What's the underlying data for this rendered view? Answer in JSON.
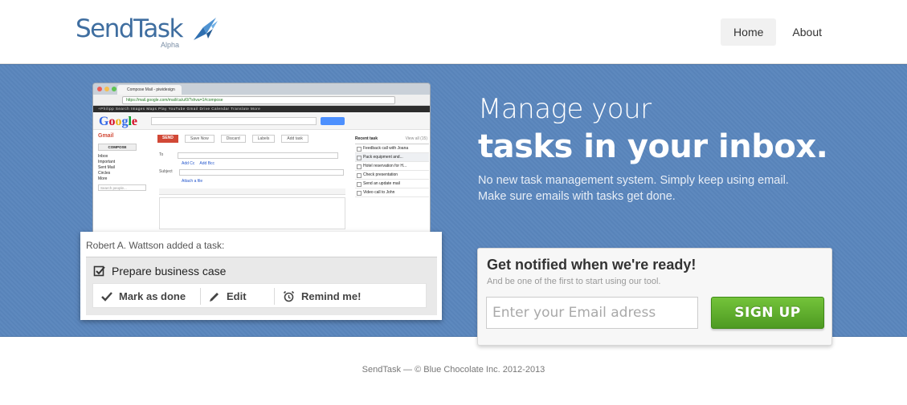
{
  "brand": {
    "name": "SendTask",
    "tagline": "Alpha"
  },
  "nav": {
    "items": [
      {
        "label": "Home"
      },
      {
        "label": "About"
      }
    ]
  },
  "browser_mock": {
    "tab_title": "Compose Mail - piwidesign",
    "url": "https://mail.google.com/mail/ca/u/0/?shva=1#compose",
    "google_bar": "+Philipp   Search   Images   Maps   Play   YouTube   Gmail   Drive   Calendar   Translate   More",
    "google_logo": "Google",
    "gmail_label": "Gmail",
    "compose_label": "COMPOSE",
    "folders": [
      "Inbox",
      "Important",
      "Sent Mail",
      "Circles",
      "More"
    ],
    "search_people": "Search people...",
    "buttons": [
      "SEND",
      "Save Now",
      "Discard",
      "Labels",
      "Add task"
    ],
    "fields": {
      "to": "To",
      "add_cc": "Add Cc",
      "add_bcc": "Add Bcc",
      "subject": "Subject",
      "attach": "Attach a file"
    },
    "recent_task_title": "Recent task",
    "view_all": "View all (15)",
    "recent_tasks": [
      "Feedback call with Joana",
      "Pack equipment and...",
      "Hotel reservation for H...",
      "Check presentation",
      "Send an update mail",
      "Video call to John"
    ]
  },
  "task_card": {
    "title": "Robert A. Wattson added a task:",
    "task": "Prepare business case",
    "actions": [
      {
        "label": "Mark as done"
      },
      {
        "label": "Edit"
      },
      {
        "label": "Remind me!"
      }
    ]
  },
  "hero": {
    "line1": "Manage your",
    "line2": "tasks in your inbox.",
    "sub1": "No new task management system. Simply keep using email.",
    "sub2": "Make sure emails with tasks get done."
  },
  "signup": {
    "title": "Get notified when we're ready!",
    "subtitle": "And be one of the first to start using our tool.",
    "email_placeholder": "Enter your Email adress",
    "email_value": "",
    "button": "SIGN UP"
  },
  "footer": {
    "text": "SendTask — © Blue Chocolate Inc. 2012-2013"
  }
}
